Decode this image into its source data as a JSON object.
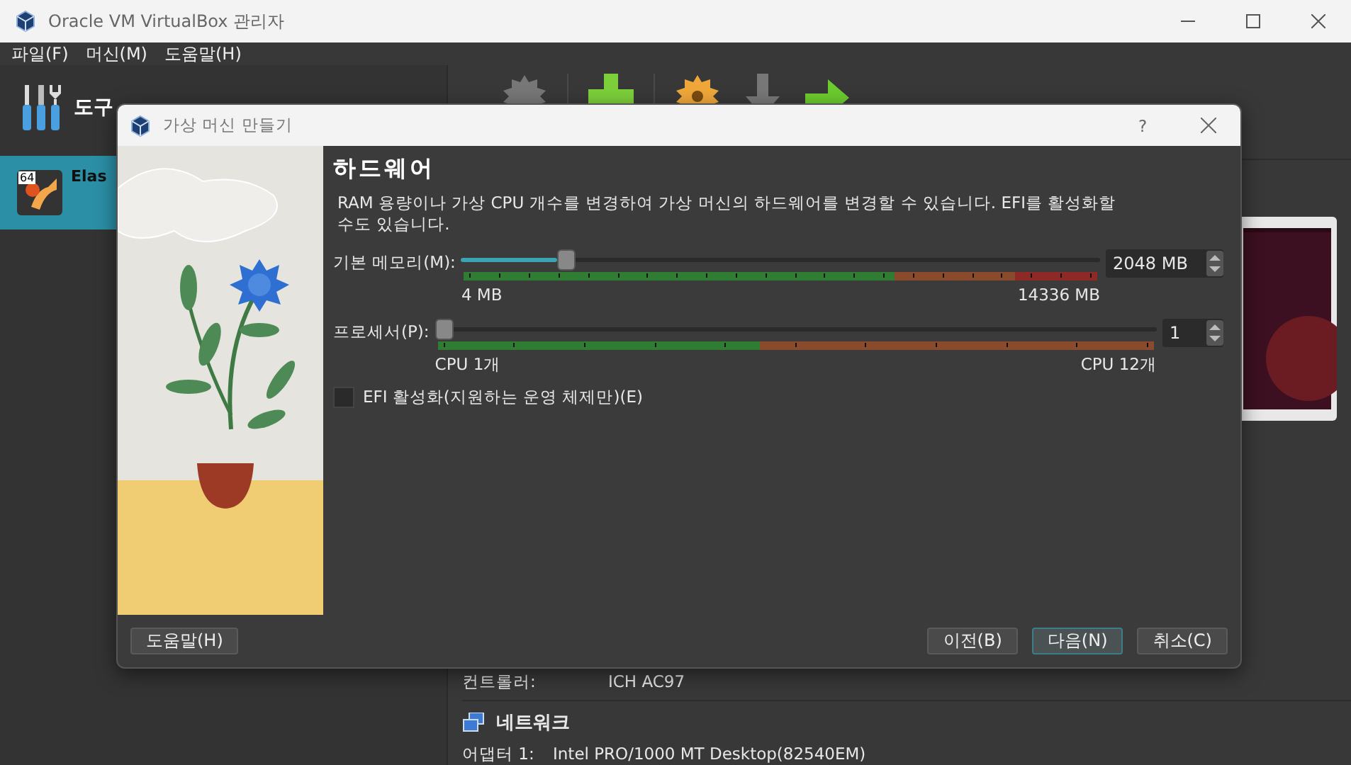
{
  "window": {
    "title": "Oracle VM VirtualBox 관리자"
  },
  "menu": [
    "파일(F)",
    "머신(M)",
    "도움말(H)"
  ],
  "sidebar": {
    "tools_label": "도구",
    "items": [
      {
        "name": "Elas",
        "badge": "64",
        "selected": true
      }
    ]
  },
  "details": {
    "rows": [
      {
        "label": "컨트롤러:",
        "value": "ICH AC97"
      }
    ],
    "network": {
      "title": "네트워크",
      "rows": [
        {
          "label": "어댑터 1:",
          "value": "Intel PRO/1000 MT Desktop(82540EM)"
        }
      ]
    }
  },
  "dialog": {
    "title": "가상 머신 만들기",
    "help": "?",
    "heading": "하드웨어",
    "description": "RAM 용량이나 가상 CPU 개수를 변경하여 가상 머신의 하드웨어를 변경할 수 있습니다. EFI를 활성화할 수도 있습니다.",
    "memory": {
      "label": "기본 메모리(M):",
      "level": 0.15,
      "min": "4 MB",
      "max": "14336 MB",
      "value": "2048 MB"
    },
    "processor": {
      "label": "프로세서(P):",
      "level": 0,
      "min": "CPU 1개",
      "max": "CPU 12개",
      "value": "1"
    },
    "efi": {
      "label": "EFI 활성화(지원하는 운영 체제만)(E)",
      "checked": false
    },
    "help_button": "도움말(H)",
    "buttons": [
      {
        "label": "이전(B)",
        "default": false
      },
      {
        "label": "다음(N)",
        "default": true
      },
      {
        "label": "취소(C)",
        "default": false
      }
    ]
  }
}
